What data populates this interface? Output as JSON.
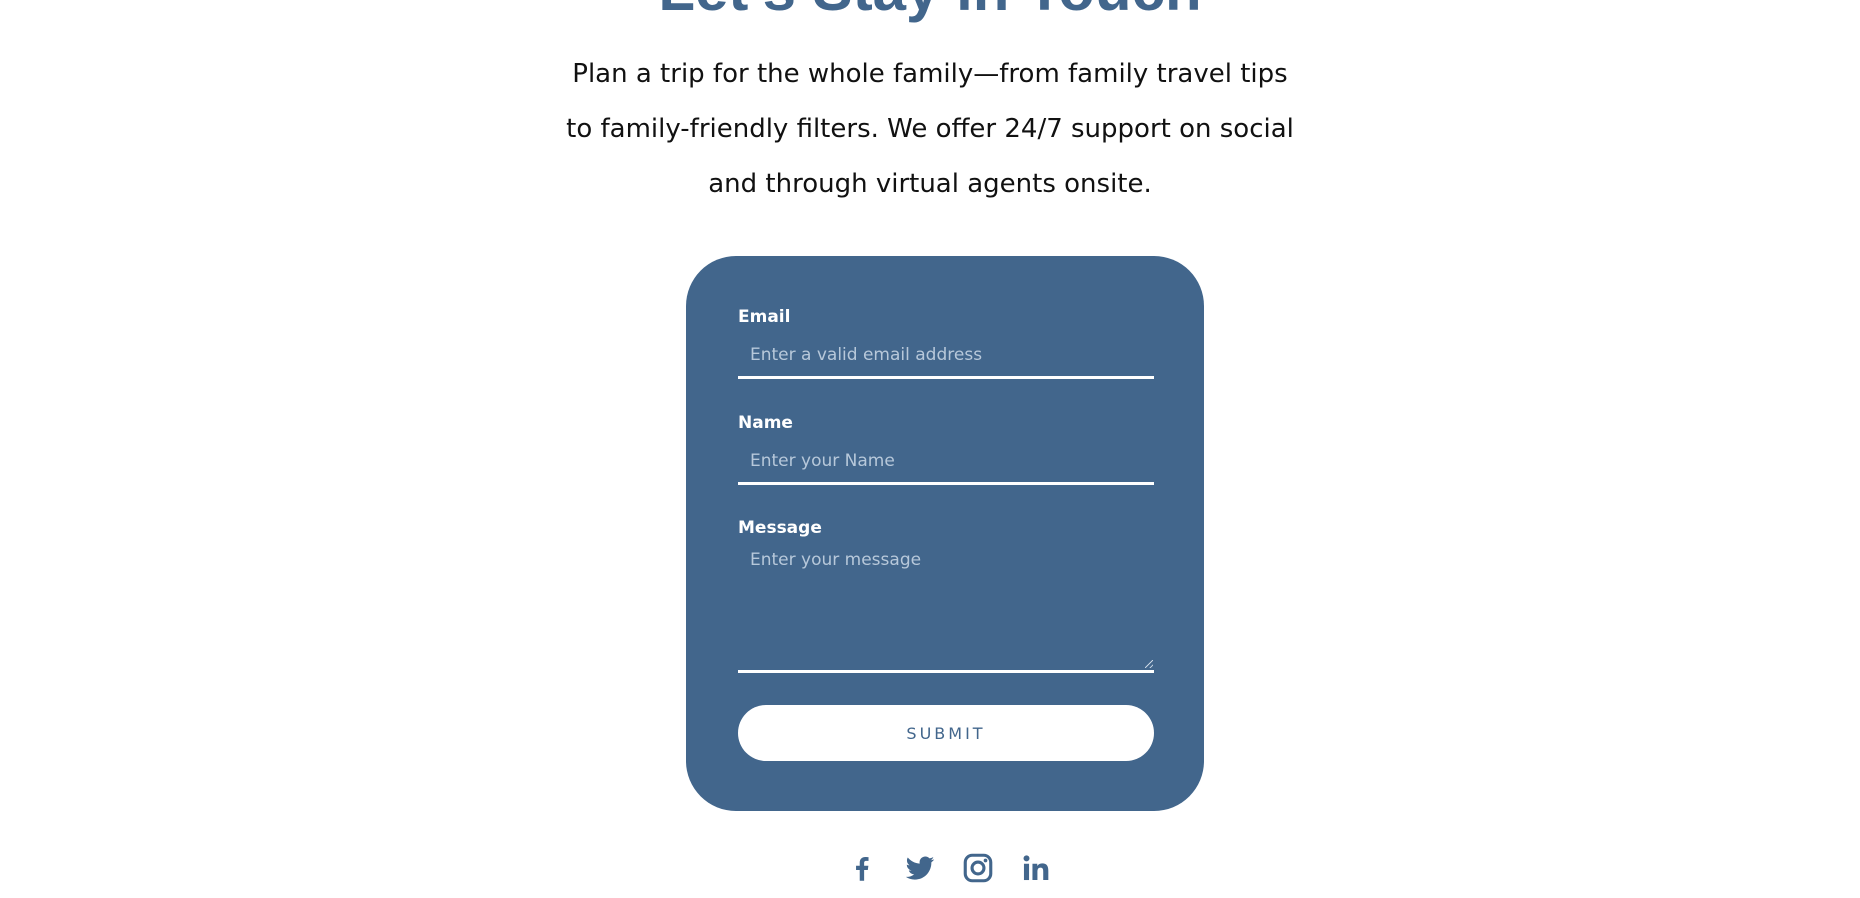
{
  "section": {
    "heading": "Let's Stay in Touch",
    "intro_line1": "Plan a trip for the whole family—from family travel tips",
    "intro_line2": "to family-friendly filters. We offer 24/7 support on social",
    "intro_line3": "and through virtual agents onsite."
  },
  "form": {
    "email": {
      "label": "Email",
      "placeholder": "Enter a valid email address",
      "value": ""
    },
    "name": {
      "label": "Name",
      "placeholder": "Enter your Name",
      "value": ""
    },
    "message": {
      "label": "Message",
      "placeholder": "Enter your message",
      "value": ""
    },
    "submit_label": "SUBMIT"
  },
  "social": {
    "icons": [
      "facebook-icon",
      "twitter-icon",
      "instagram-icon",
      "linkedin-icon"
    ]
  },
  "colors": {
    "accent": "#42668c",
    "background": "#ffffff",
    "text": "#111111"
  }
}
